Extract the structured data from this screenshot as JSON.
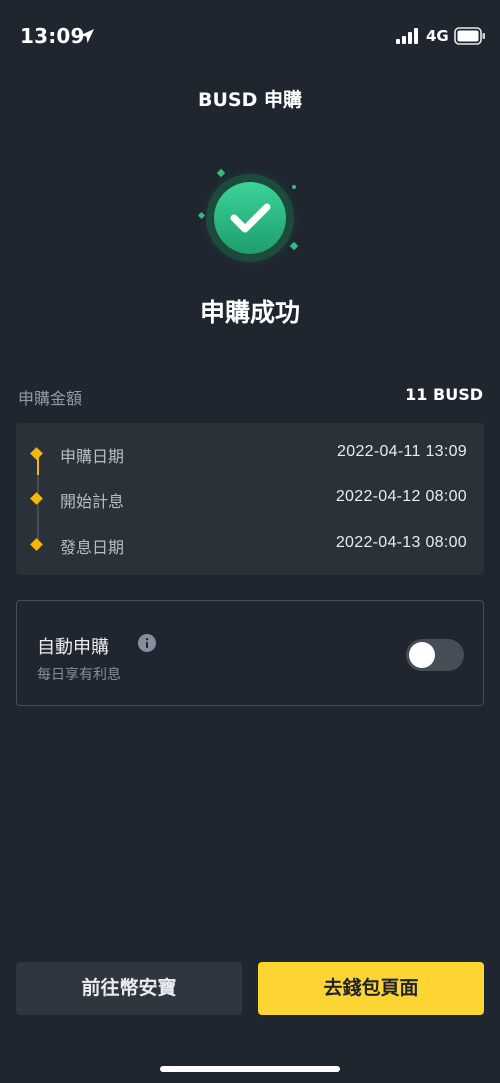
{
  "status_bar": {
    "time": "13:09",
    "network": "4G",
    "location_icon": "location-arrow-icon",
    "signal_icon": "cellular-signal-icon",
    "battery_icon": "battery-icon"
  },
  "header": {
    "title": "BUSD 申購"
  },
  "success": {
    "icon": "check-circle-icon",
    "title": "申購成功"
  },
  "summary": {
    "amount_label": "申購金額",
    "amount_value": "11 BUSD"
  },
  "timeline": [
    {
      "label": "申購日期",
      "date": "2022-04-11 13:09"
    },
    {
      "label": "開始計息",
      "date": "2022-04-12 08:00"
    },
    {
      "label": "發息日期",
      "date": "2022-04-13 08:00"
    }
  ],
  "auto_subscribe": {
    "title": "自動申購",
    "subtitle": "每日享有利息",
    "info_icon": "info-icon",
    "enabled": false
  },
  "actions": {
    "secondary_label": "前往幣安寶",
    "primary_label": "去錢包頁面"
  },
  "colors": {
    "background": "#1f2630",
    "card": "#2b3139",
    "accent_yellow": "#fcd535",
    "timeline_yellow": "#f0b90b",
    "success_green": "#2ebd85"
  }
}
